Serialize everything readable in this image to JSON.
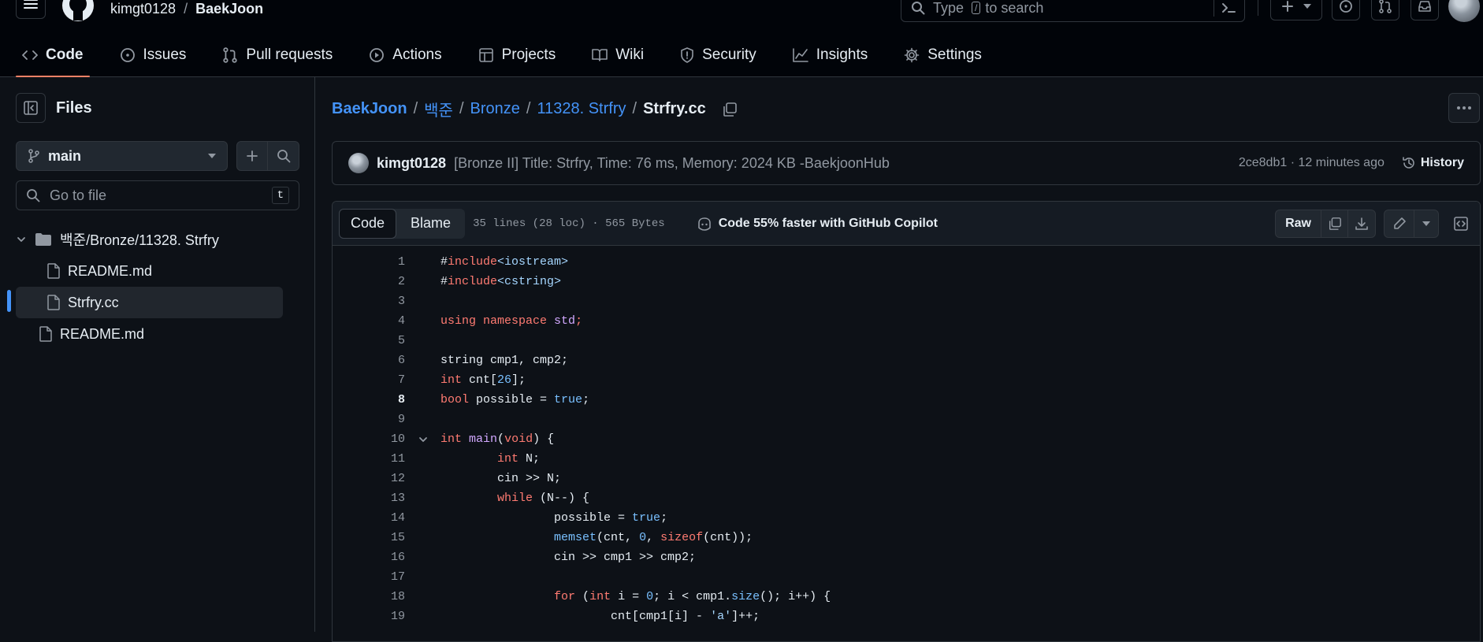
{
  "header": {
    "owner": "kimgt0128",
    "separator": "/",
    "repo": "BaekJoon",
    "search_prefix": "Type",
    "search_key": "/",
    "search_suffix": "to search"
  },
  "repo_tabs": [
    {
      "label": "Code",
      "icon": "code-icon"
    },
    {
      "label": "Issues",
      "icon": "issue-icon"
    },
    {
      "label": "Pull requests",
      "icon": "pull-request-icon"
    },
    {
      "label": "Actions",
      "icon": "play-icon"
    },
    {
      "label": "Projects",
      "icon": "table-icon"
    },
    {
      "label": "Wiki",
      "icon": "book-icon"
    },
    {
      "label": "Security",
      "icon": "shield-icon"
    },
    {
      "label": "Insights",
      "icon": "graph-icon"
    },
    {
      "label": "Settings",
      "icon": "gear-icon"
    }
  ],
  "sidebar": {
    "title": "Files",
    "branch": "main",
    "goto_placeholder": "Go to file",
    "goto_key": "t",
    "tree": [
      {
        "label": "백준/Bronze/11328. Strfry",
        "type": "folder"
      },
      {
        "label": "README.md",
        "type": "file"
      },
      {
        "label": "Strfry.cc",
        "type": "file",
        "selected": true
      },
      {
        "label": "README.md",
        "type": "file"
      }
    ]
  },
  "breadcrumb": {
    "repo": "BaekJoon",
    "sep": "/",
    "dir1": "백준",
    "dir2": "Bronze",
    "dir3": "11328. Strfry",
    "file": "Strfry.cc"
  },
  "commit": {
    "author": "kimgt0128",
    "message": "[Bronze II] Title: Strfry, Time: 76 ms, Memory: 2024 KB -BaekjoonHub",
    "meta": "2ce8db1 · 12 minutes ago",
    "history_label": "History"
  },
  "file_toolbar": {
    "code_tab": "Code",
    "blame_tab": "Blame",
    "stats": "35 lines (28 loc) · 565 Bytes",
    "copilot": "Code 55% faster with GitHub Copilot",
    "raw": "Raw"
  },
  "code": {
    "current_line": 8,
    "lines": [
      {
        "n": "1",
        "html": "#<span class=\"kw\">include</span><span class=\"st\">&lt;iostream&gt;</span>"
      },
      {
        "n": "2",
        "html": "#<span class=\"kw\">include</span><span class=\"st\">&lt;cstring&gt;</span>"
      },
      {
        "n": "3",
        "html": ""
      },
      {
        "n": "4",
        "html": "<span class=\"kw\">using namespace</span> <span class=\"fn\">std</span><span class=\"kw\">;</span>"
      },
      {
        "n": "5",
        "html": ""
      },
      {
        "n": "6",
        "html": "string cmp1, cmp2;"
      },
      {
        "n": "7",
        "html": "<span class=\"kw\">int</span> cnt[<span class=\"nu\">26</span>];"
      },
      {
        "n": "8",
        "html": "<span class=\"kw\">bool</span> possible = <span class=\"nu\">true</span>;"
      },
      {
        "n": "9",
        "html": ""
      },
      {
        "n": "10",
        "html": "<span class=\"kw\">int</span> <span class=\"fn\">main</span>(<span class=\"kw\">void</span>) {",
        "fold": true
      },
      {
        "n": "11",
        "html": "        <span class=\"kw\">int</span> N;"
      },
      {
        "n": "12",
        "html": "        cin &gt;&gt; N;"
      },
      {
        "n": "13",
        "html": "        <span class=\"kw\">while</span> (N--) {"
      },
      {
        "n": "14",
        "html": "                possible = <span class=\"nu\">true</span>;"
      },
      {
        "n": "15",
        "html": "                <span class=\"nu\">memset</span>(cnt, <span class=\"nu\">0</span>, <span class=\"kw\">sizeof</span>(cnt));"
      },
      {
        "n": "16",
        "html": "                cin &gt;&gt; cmp1 &gt;&gt; cmp2;"
      },
      {
        "n": "17",
        "html": ""
      },
      {
        "n": "18",
        "html": "                <span class=\"kw\">for</span> (<span class=\"kw\">int</span> i = <span class=\"nu\">0</span>; i &lt; cmp1.<span class=\"nu\">size</span>(); i++) {"
      },
      {
        "n": "19",
        "html": "                        cnt[cmp1[i] - <span class=\"st\">'a'</span>]++;"
      }
    ]
  }
}
